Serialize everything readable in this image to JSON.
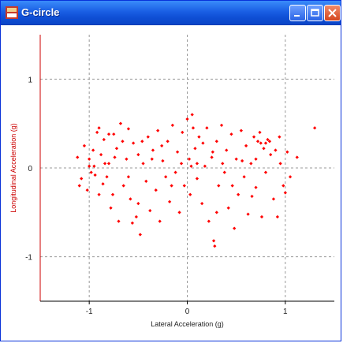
{
  "window": {
    "title": "G-circle"
  },
  "colors": {
    "titlebar": "#1a5fe4",
    "point": "#ff0000",
    "axis": "#cc0000",
    "grid": "#999999"
  },
  "icons": {
    "app": "app-icon",
    "minimize": "minimize-icon",
    "maximize": "maximize-icon",
    "close": "close-icon"
  },
  "chart_data": {
    "type": "scatter",
    "title": "",
    "xlabel": "Lateral Acceleration (g)",
    "ylabel": "Longitudinal Acceleration (g)",
    "xlim": [
      -1.5,
      1.5
    ],
    "ylim": [
      -1.5,
      1.5
    ],
    "xticks": [
      "-1",
      "0",
      "1"
    ],
    "yticks": [
      "1",
      "0",
      "-1"
    ],
    "grid": true,
    "points": [
      [
        -1.12,
        0.12
      ],
      [
        -1.1,
        -0.2
      ],
      [
        -1.05,
        0.25
      ],
      [
        -1.0,
        0.1
      ],
      [
        -0.98,
        -0.05
      ],
      [
        -0.95,
        0.02
      ],
      [
        -0.92,
        0.4
      ],
      [
        -0.9,
        -0.3
      ],
      [
        -0.88,
        0.15
      ],
      [
        -0.85,
        0.32
      ],
      [
        -0.82,
        -0.1
      ],
      [
        -0.8,
        0.05
      ],
      [
        -0.78,
        -0.45
      ],
      [
        -0.75,
        0.38
      ],
      [
        -0.72,
        0.22
      ],
      [
        -0.7,
        -0.6
      ],
      [
        -0.68,
        0.5
      ],
      [
        -0.65,
        -0.2
      ],
      [
        -0.62,
        0.1
      ],
      [
        -0.6,
        0.44
      ],
      [
        -0.58,
        -0.35
      ],
      [
        -0.55,
        0.28
      ],
      [
        -0.52,
        -0.55
      ],
      [
        -0.5,
        0.15
      ],
      [
        -0.48,
        -0.75
      ],
      [
        -0.45,
        0.05
      ],
      [
        -0.42,
        -0.15
      ],
      [
        -0.4,
        0.35
      ],
      [
        -0.38,
        -0.48
      ],
      [
        -0.35,
        0.2
      ],
      [
        -0.32,
        -0.25
      ],
      [
        -0.3,
        0.42
      ],
      [
        -0.28,
        -0.6
      ],
      [
        -0.25,
        0.08
      ],
      [
        -0.22,
        -0.1
      ],
      [
        -0.2,
        0.3
      ],
      [
        -0.18,
        -0.38
      ],
      [
        -0.15,
        0.48
      ],
      [
        -0.12,
        -0.05
      ],
      [
        -0.1,
        0.18
      ],
      [
        -0.08,
        -0.5
      ],
      [
        -0.05,
        0.4
      ],
      [
        -0.03,
        -0.2
      ],
      [
        0.0,
        0.55
      ],
      [
        0.02,
        0.1
      ],
      [
        0.03,
        -0.3
      ],
      [
        0.05,
        0.6
      ],
      [
        0.08,
        0.22
      ],
      [
        0.1,
        -0.12
      ],
      [
        0.12,
        0.35
      ],
      [
        0.15,
        -0.4
      ],
      [
        0.18,
        0.02
      ],
      [
        0.2,
        0.45
      ],
      [
        0.22,
        -0.6
      ],
      [
        0.25,
        0.12
      ],
      [
        0.27,
        -0.82
      ],
      [
        0.28,
        -0.88
      ],
      [
        0.3,
        0.3
      ],
      [
        0.32,
        -0.2
      ],
      [
        0.35,
        0.48
      ],
      [
        0.38,
        -0.05
      ],
      [
        0.4,
        0.2
      ],
      [
        0.42,
        -0.45
      ],
      [
        0.45,
        0.38
      ],
      [
        0.48,
        -0.68
      ],
      [
        0.5,
        0.1
      ],
      [
        0.52,
        -0.3
      ],
      [
        0.55,
        0.42
      ],
      [
        0.58,
        -0.1
      ],
      [
        0.6,
        0.25
      ],
      [
        0.62,
        -0.52
      ],
      [
        0.65,
        0.05
      ],
      [
        0.68,
        0.35
      ],
      [
        0.7,
        -0.22
      ],
      [
        0.72,
        0.3
      ],
      [
        0.75,
        0.28
      ],
      [
        0.76,
        -0.55
      ],
      [
        0.78,
        0.22
      ],
      [
        0.8,
        -0.05
      ],
      [
        0.82,
        0.32
      ],
      [
        0.85,
        0.15
      ],
      [
        0.88,
        -0.35
      ],
      [
        0.9,
        0.2
      ],
      [
        0.92,
        -0.55
      ],
      [
        0.95,
        0.05
      ],
      [
        0.98,
        -0.2
      ],
      [
        1.0,
        -0.28
      ],
      [
        1.02,
        0.18
      ],
      [
        1.05,
        -0.1
      ],
      [
        1.12,
        0.12
      ],
      [
        1.3,
        0.45
      ],
      [
        -1.08,
        -0.12
      ],
      [
        -1.0,
        0.02
      ],
      [
        -0.96,
        0.2
      ],
      [
        -0.9,
        0.45
      ],
      [
        -0.86,
        -0.18
      ],
      [
        -0.84,
        0.05
      ],
      [
        -0.8,
        0.38
      ],
      [
        -0.76,
        -0.3
      ],
      [
        -0.74,
        0.12
      ],
      [
        -0.66,
        0.3
      ],
      [
        -0.6,
        -0.1
      ],
      [
        -0.56,
        -0.62
      ],
      [
        -0.46,
        0.3
      ],
      [
        -0.36,
        0.1
      ],
      [
        -0.26,
        0.25
      ],
      [
        -0.16,
        -0.2
      ],
      [
        -0.06,
        0.05
      ],
      [
        0.06,
        0.45
      ],
      [
        0.16,
        0.28
      ],
      [
        0.26,
        0.18
      ],
      [
        0.36,
        0.05
      ],
      [
        0.46,
        -0.2
      ],
      [
        0.56,
        0.08
      ],
      [
        0.66,
        -0.32
      ],
      [
        0.74,
        0.4
      ],
      [
        0.84,
        0.3
      ],
      [
        0.94,
        0.35
      ],
      [
        -1.02,
        -0.25
      ],
      [
        -0.94,
        -0.08
      ],
      [
        0.04,
        0.02
      ],
      [
        0.1,
        0.05
      ],
      [
        0.7,
        0.1
      ],
      [
        -0.5,
        -0.4
      ],
      [
        0.3,
        -0.5
      ],
      [
        0.8,
        0.28
      ]
    ]
  }
}
